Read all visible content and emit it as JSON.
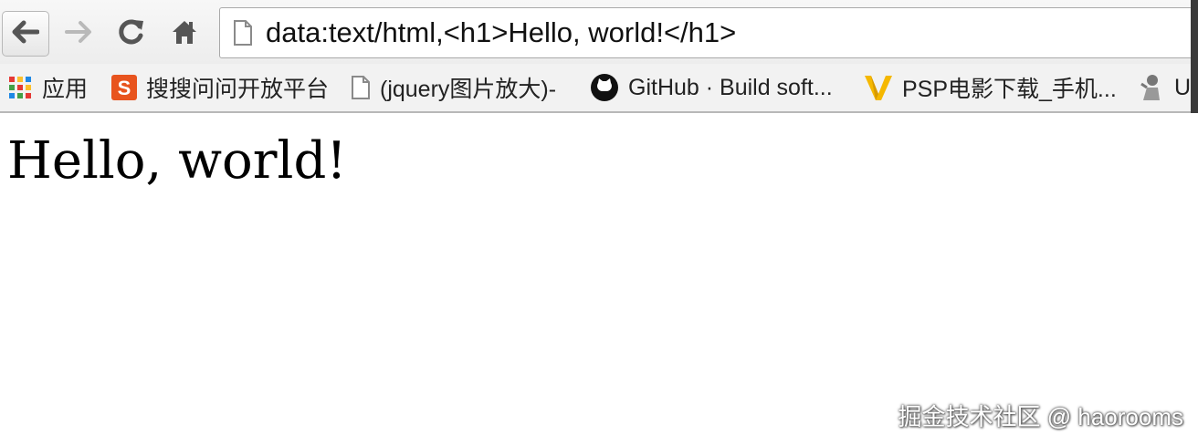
{
  "toolbar": {
    "back_icon": "arrow-left-icon",
    "forward_icon": "arrow-right-icon",
    "reload_icon": "reload-icon",
    "home_icon": "home-icon",
    "url": "data:text/html,<h1>Hello, world!</h1>"
  },
  "bookmarks": [
    {
      "label": "应用",
      "icon": "apps-grid-icon"
    },
    {
      "label": "搜搜问问开放平台",
      "icon": "sogou-icon"
    },
    {
      "label": "(jquery图片放大)-",
      "icon": "page-icon"
    },
    {
      "label": "GitHub · Build soft...",
      "icon": "github-icon"
    },
    {
      "label": "PSP电影下载_手机...",
      "icon": "v-logo-icon"
    },
    {
      "label": "U",
      "icon": "figure-icon"
    }
  ],
  "page": {
    "heading": "Hello, world!"
  },
  "watermark": "掘金技术社区 @ haorooms",
  "colors": {
    "chrome_bg": "#f2f2f2",
    "sogou_orange": "#e8541e",
    "v_logo_yellow": "#f5b800"
  }
}
